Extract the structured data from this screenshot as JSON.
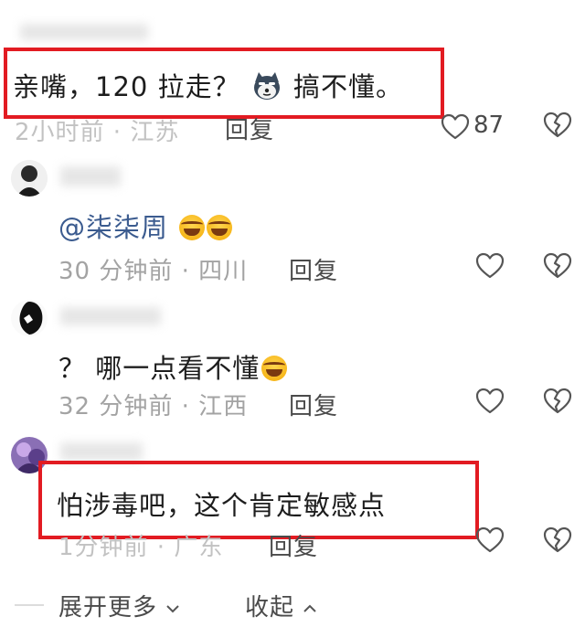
{
  "comments": [
    {
      "username": "",
      "text": "亲嘴，120 拉走？",
      "text_suffix": "搞不懂。",
      "time_location": "2小时前 · 江苏",
      "reply_label": "回复",
      "like_count": "87"
    },
    {
      "username": "",
      "text": "@柒柒周",
      "time_location": "30 分钟前 · 四川",
      "reply_label": "回复"
    },
    {
      "username": "",
      "text": "？ 哪一点看不懂",
      "time_location": "32 分钟前 · 江西",
      "reply_label": "回复"
    },
    {
      "username": "",
      "text": "怕涉毒吧，这个肯定敏感点",
      "time_location": "1分钟前 · 广东",
      "reply_label": "回复"
    }
  ],
  "footer": {
    "expand_label": "展开更多",
    "collapse_label": "收起"
  },
  "colors": {
    "highlight_box": "#e21b22",
    "mention": "#3b5b8f",
    "meta": "#a3a3a3"
  },
  "icons": [
    "heart-icon",
    "broken-heart-icon",
    "husky-emoji-icon",
    "laughing-emoji-icon",
    "chevron-down-icon",
    "chevron-up-icon"
  ]
}
